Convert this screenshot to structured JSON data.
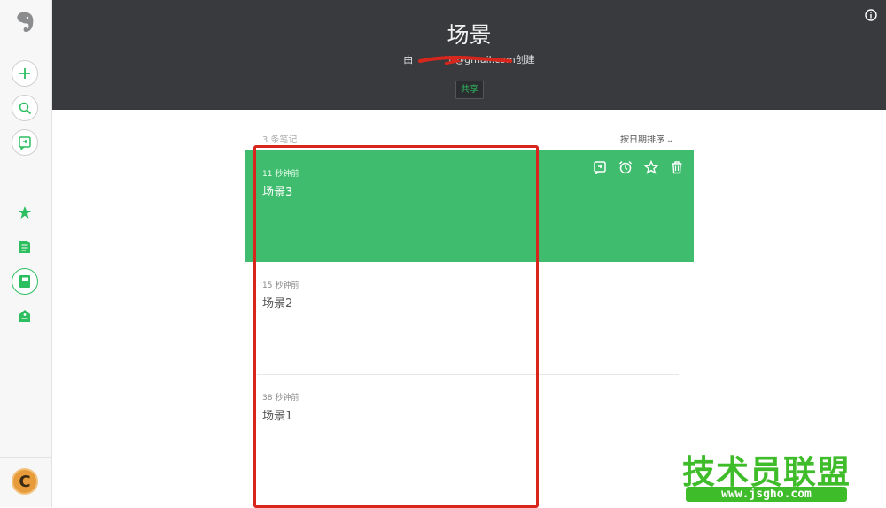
{
  "sidebar": {
    "icons": [
      "evernote-elephant-icon",
      "new-note-icon",
      "search-icon",
      "work-chat-icon",
      "shortcuts-star-icon",
      "notes-icon",
      "notebooks-icon",
      "tags-icon",
      "account-avatar-icon"
    ],
    "avatar_letter": "C"
  },
  "header": {
    "title": "场景",
    "owner_prefix": "由",
    "owner_email": "if@gmail.com",
    "owner_suffix": "创建",
    "share_label": "共享"
  },
  "list": {
    "count": "3 条笔记",
    "sort_label": "按日期排序"
  },
  "notes": [
    {
      "time": "11 秒钟前",
      "title": "场景3",
      "selected": true
    },
    {
      "time": "15 秒钟前",
      "title": "场景2",
      "selected": false
    },
    {
      "time": "38 秒钟前",
      "title": "场景1",
      "selected": false
    }
  ],
  "watermark": {
    "title": "技术员联盟",
    "url": "www.jsgho.com"
  },
  "colors": {
    "header_bg": "#383a3e",
    "accent_green": "#2dbe60",
    "selected_note_bg": "#3fbc6d",
    "annotation_red": "#d9261c"
  }
}
